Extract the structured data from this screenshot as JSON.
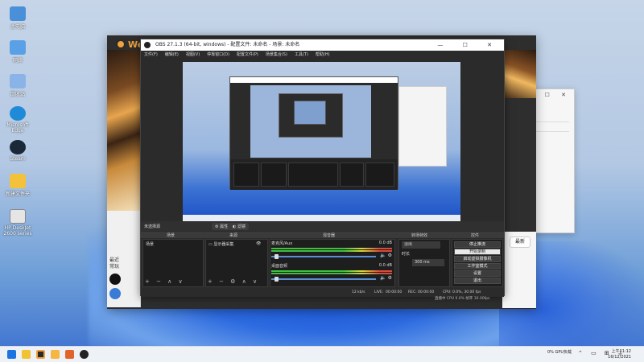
{
  "desktop": {
    "icons": [
      {
        "label": "此电脑",
        "icon": "this-pc-icon",
        "color": "#4a90d9"
      },
      {
        "label": "网络",
        "icon": "network-icon",
        "color": "#5aa0e6"
      },
      {
        "label": "回收站",
        "icon": "recycle-bin-icon",
        "color": "#8ab4e8"
      },
      {
        "label": "Microsoft Edge",
        "icon": "edge-icon",
        "color": "#1f8ad8"
      },
      {
        "label": "Steam",
        "icon": "steam-icon",
        "color": "#1b2838"
      },
      {
        "label": "新建文件夹",
        "icon": "folder-icon",
        "color": "#f3c13a"
      },
      {
        "label": "HP DeskJet 2600 series",
        "icon": "printer-icon",
        "color": "#e5e5e5"
      }
    ]
  },
  "brand": {
    "text": "Wee"
  },
  "obs": {
    "title": "OBS 27.1.3 (64-bit, windows) - 配置文件: 未命名 - 场景: 未命名",
    "menu": [
      "文件(F)",
      "编辑(E)",
      "视图(V)",
      "停靠窗口(D)",
      "配置文件(P)",
      "场景集合(S)",
      "工具(T)",
      "帮助(H)"
    ],
    "no_source": "未选择源",
    "properties_label": "属性",
    "filters_label": "滤镜",
    "docks": {
      "scenes_header": "场景",
      "sources_header": "来源",
      "mixer_header": "混音器",
      "transitions_header": "转场特效",
      "controls_header": "控件"
    },
    "scenes": [
      "场景"
    ],
    "sources": [
      "显示器采集"
    ],
    "mixer": [
      {
        "name": "麦克风/Aux",
        "db": "0.0 dB"
      },
      {
        "name": "桌面音频",
        "db": "0.0 dB"
      }
    ],
    "transitions": {
      "selected": "淡出",
      "duration_label": "时长",
      "duration_value": "300 ms"
    },
    "controls": [
      {
        "label": "停止推流",
        "active": false
      },
      {
        "label": "开始录制",
        "active": true
      },
      {
        "label": "启动虚拟摄像机",
        "active": false
      },
      {
        "label": "工作室模式",
        "active": false
      },
      {
        "label": "设置",
        "active": false
      },
      {
        "label": "退出",
        "active": false
      }
    ],
    "status": {
      "live": "LIVE:",
      "live_time": "00:00:00",
      "rec": "REC:",
      "rec_time": "00:00:00",
      "cpu": "CPU: 0.0%, 30.00 fps",
      "kbps": "12 kb/s"
    }
  },
  "capture_status": "直播中 CPU 0.0% 帧率 30.00fps",
  "side_panel": {
    "label": "最近常玩",
    "tag": "最新"
  },
  "taskbar": {
    "icons": [
      "start-icon",
      "file-explorer-icon",
      "game-launcher-icon",
      "app-icon",
      "store-icon",
      "obs-icon"
    ],
    "tray_text": "0% GPU负载",
    "time": "上午11:12",
    "date": "16/12/2021"
  }
}
